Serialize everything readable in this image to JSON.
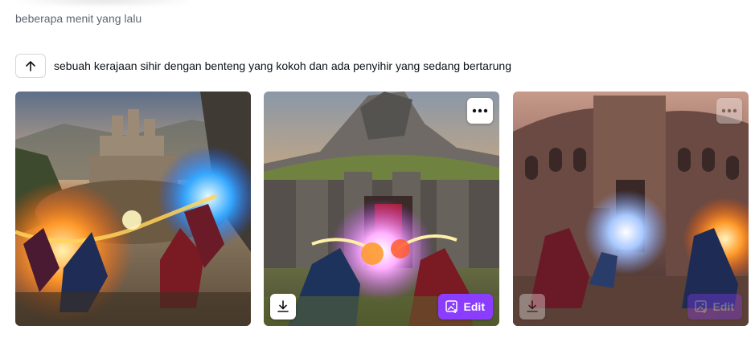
{
  "history": {
    "timestamp": "beberapa menit yang lalu",
    "prompt": "sebuah kerajaan sihir dengan benteng yang kokoh dan ada penyihir yang sedang bertarung"
  },
  "results": [
    {
      "alt": "",
      "show_more": false,
      "show_download": false,
      "show_edit": false
    },
    {
      "alt": "",
      "show_more": true,
      "show_download": true,
      "show_edit": true,
      "edit_label": "Edit"
    },
    {
      "alt": "",
      "show_more": true,
      "show_download": true,
      "show_edit": true,
      "edit_label": "Edit",
      "faded_controls": true
    }
  ],
  "colors": {
    "accent": "#8b3dff",
    "muted_text": "#5e6671",
    "text": "#0d1216"
  },
  "icons": {
    "prompt_reuse": "arrow-up-icon",
    "more": "more-horizontal-icon",
    "download": "download-icon",
    "edit": "image-edit-icon"
  }
}
